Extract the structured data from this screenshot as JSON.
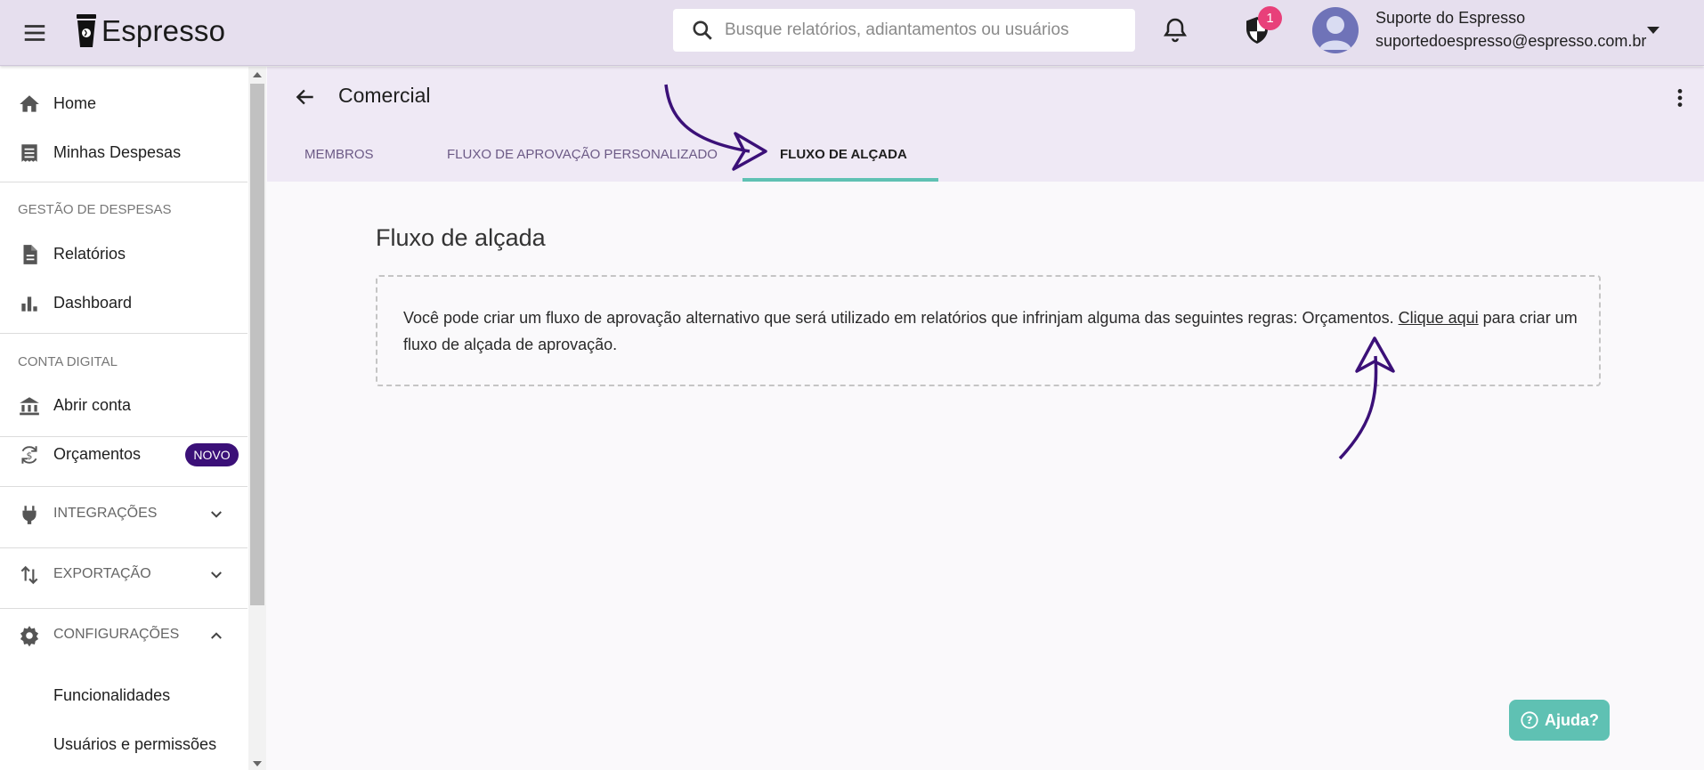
{
  "app": {
    "name": "Espresso"
  },
  "header": {
    "search_placeholder": "Busque relatórios, adiantamentos ou usuários",
    "notification_badge": "1",
    "user": {
      "name": "Suporte do Espresso",
      "email": "suportedoespresso@espresso.com.br"
    }
  },
  "sidebar": {
    "home": "Home",
    "my_expenses": "Minhas Despesas",
    "section_expenses": "GESTÃO DE DESPESAS",
    "reports": "Relatórios",
    "dashboard": "Dashboard",
    "section_digital": "CONTA DIGITAL",
    "open_account": "Abrir conta",
    "budgets": "Orçamentos",
    "budgets_badge": "NOVO",
    "integrations": "INTEGRAÇÕES",
    "export": "EXPORTAÇÃO",
    "settings": "CONFIGURAÇÕES",
    "features": "Funcionalidades",
    "users_permissions": "Usuários e permissões"
  },
  "page": {
    "title": "Comercial",
    "tabs": [
      "MEMBROS",
      "FLUXO DE APROVAÇÃO PERSONALIZADO",
      "FLUXO DE ALÇADA"
    ],
    "active_tab": "FLUXO DE ALÇADA"
  },
  "content": {
    "title": "Fluxo de alçada",
    "text_before": "Você pode criar um fluxo de aprovação alternativo que será utilizado em relatórios que infrinjam alguma das seguintes regras: Orçamentos. ",
    "link": "Clique aqui",
    "text_after": " para criar um fluxo de alçada de aprovação."
  },
  "help_button": "Ajuda?",
  "colors": {
    "topbar": "#e6dfee",
    "accent_teal": "#5fc1b3",
    "badge_purple": "#3b1078",
    "notification_pink": "#e8407a",
    "arrow": "#3b1078"
  }
}
